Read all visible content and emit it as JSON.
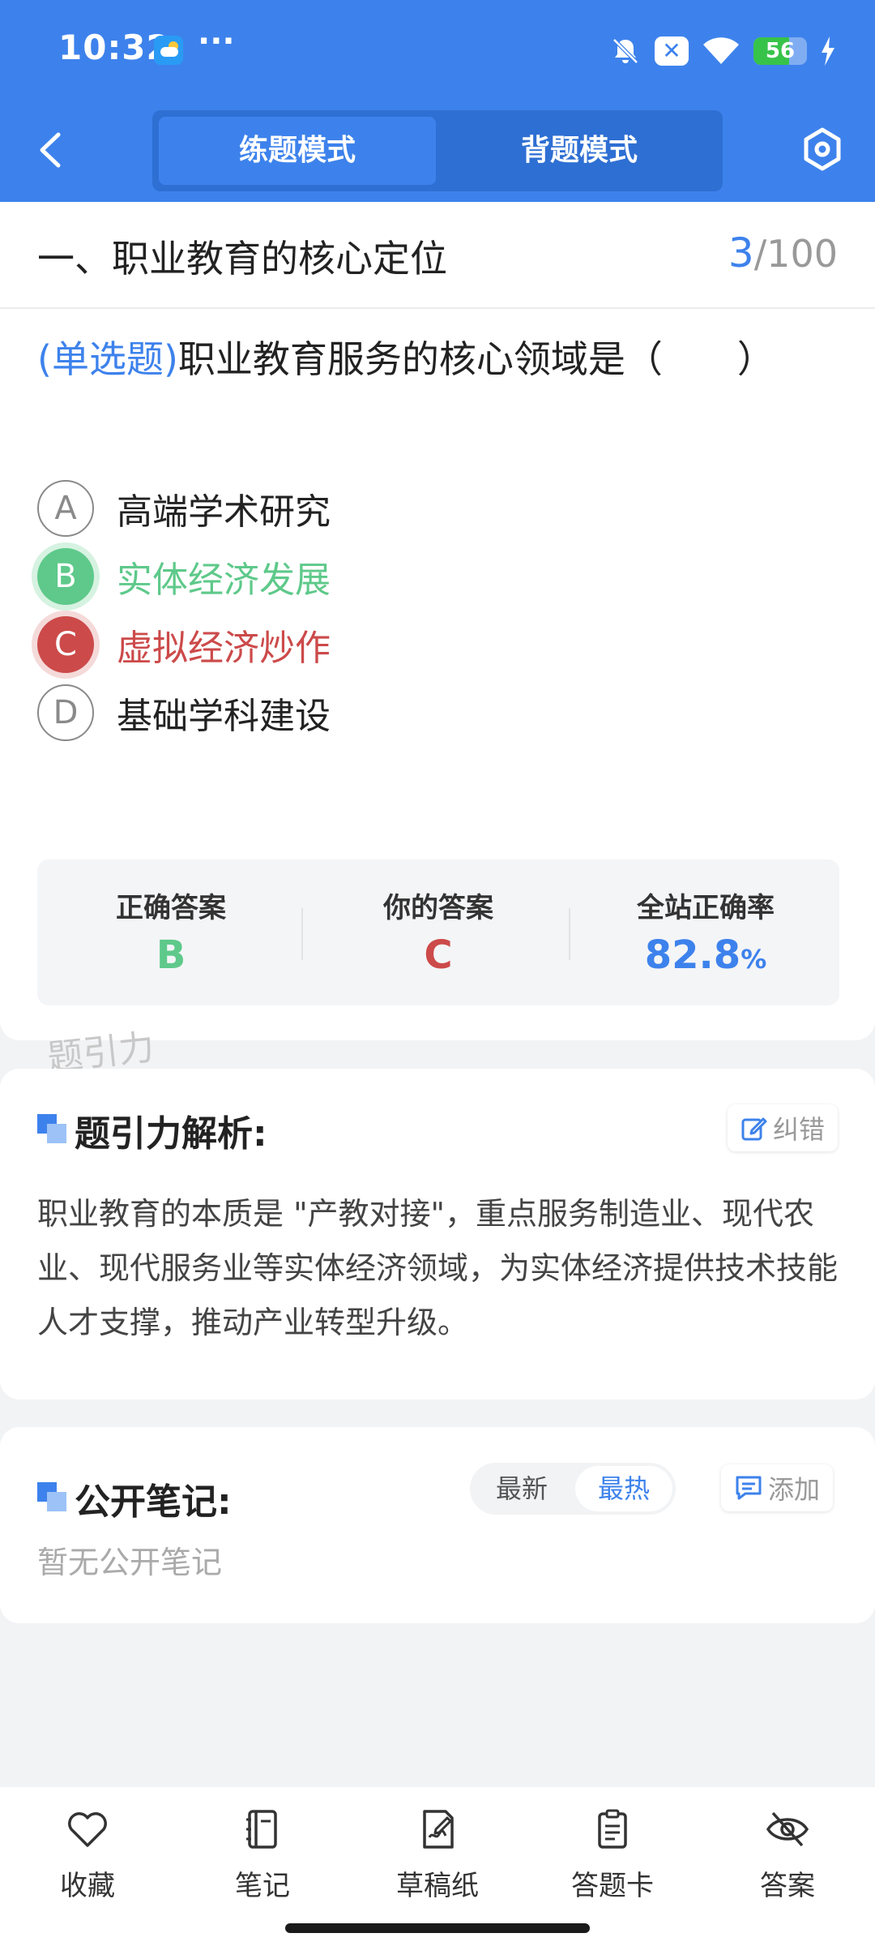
{
  "status_bar": {
    "time": "10:32",
    "more": "···",
    "battery": "56"
  },
  "nav": {
    "tabs": [
      {
        "label": "练题模式"
      },
      {
        "label": "背题模式"
      }
    ]
  },
  "question": {
    "section_title": "一、职业教育的核心定位",
    "current": "3",
    "total": "/100",
    "type_tag": "(单选题)",
    "text": "职业教育服务的核心领域是（　　）",
    "options": [
      {
        "letter": "A",
        "text": "高端学术研究"
      },
      {
        "letter": "B",
        "text": "实体经济发展"
      },
      {
        "letter": "C",
        "text": "虚拟经济炒作"
      },
      {
        "letter": "D",
        "text": "基础学科建设"
      }
    ]
  },
  "stats": {
    "correct_label": "正确答案",
    "correct_value": "B",
    "yours_label": "你的答案",
    "yours_value": "C",
    "rate_label": "全站正确率",
    "rate_value": "82.8",
    "rate_unit": "%"
  },
  "watermark": "题引力",
  "analysis": {
    "title": "题引力解析:",
    "report_label": "纠错",
    "text": "职业教育的本质是 \"产教对接\"，重点服务制造业、现代农业、现代服务业等实体经济领域，为实体经济提供技术技能人才支撑，推动产业转型升级。"
  },
  "notes": {
    "title": "公开笔记:",
    "sort_new": "最新",
    "sort_hot": "最热",
    "sort_selected": "最热",
    "add_label": "添加",
    "empty_text": "暂无公开笔记"
  },
  "bottom_bar": [
    {
      "label": "收藏",
      "icon": "heart-icon"
    },
    {
      "label": "笔记",
      "icon": "notebook-icon"
    },
    {
      "label": "草稿纸",
      "icon": "draft-paper-icon"
    },
    {
      "label": "答题卡",
      "icon": "answer-card-icon"
    },
    {
      "label": "答案",
      "icon": "eye-off-icon"
    }
  ],
  "colors": {
    "primary": "#3d82ec",
    "correct": "#5ec98a",
    "wrong": "#cc4a4a"
  }
}
